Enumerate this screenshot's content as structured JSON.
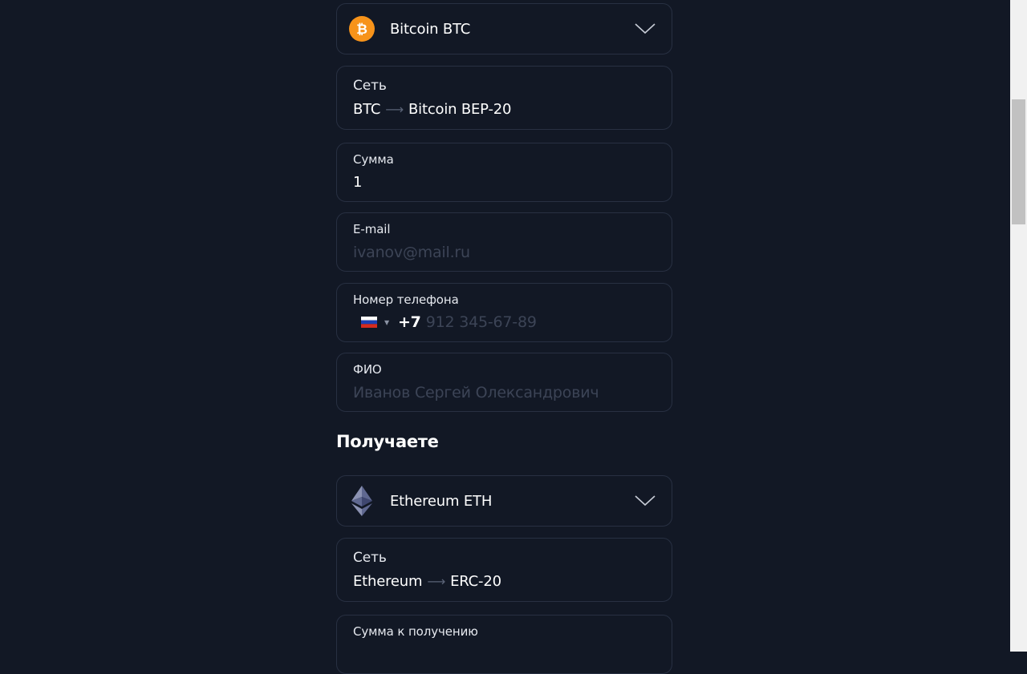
{
  "send": {
    "currency": {
      "label": "Bitcoin BTC",
      "icon": "bitcoin-icon",
      "color": "#f7931a"
    },
    "network": {
      "label": "Сеть",
      "from": "BTC",
      "to": "Bitcoin BEP-20"
    },
    "amount": {
      "label": "Сумма",
      "value": "1"
    },
    "email": {
      "label": "E-mail",
      "placeholder": "ivanov@mail.ru"
    },
    "phone": {
      "label": "Номер телефона",
      "country_flag": "russia-flag-icon",
      "prefix": "+7",
      "placeholder": "912 345-67-89"
    },
    "name": {
      "label": "ФИО",
      "placeholder": "Иванов Сергей Олександрович"
    }
  },
  "receive": {
    "title": "Получаете",
    "currency": {
      "label": "Ethereum ETH",
      "icon": "ethereum-icon"
    },
    "network": {
      "label": "Сеть",
      "from": "Ethereum",
      "to": "ERC-20"
    },
    "amount": {
      "label": "Сумма к получению"
    }
  },
  "colors": {
    "background": "#121825",
    "border": "#283042",
    "placeholder": "#3c4456"
  }
}
